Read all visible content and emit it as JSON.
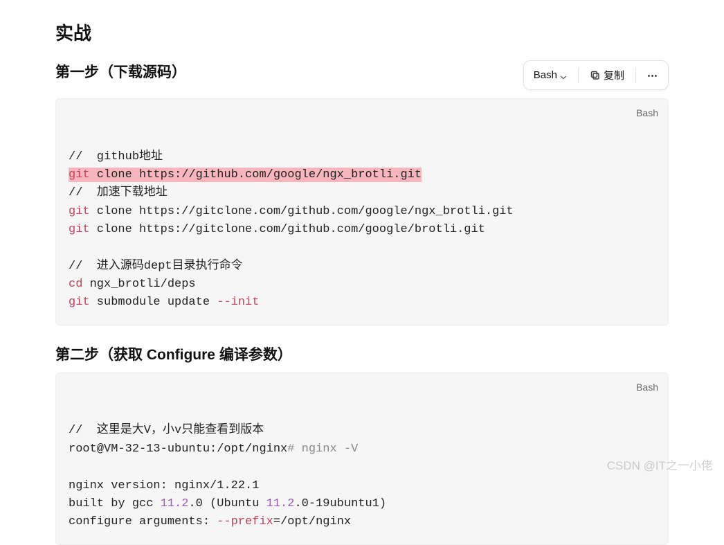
{
  "title": "实战",
  "toolbar": {
    "lang": "Bash",
    "copy": "复制",
    "more": "⋯"
  },
  "step1": {
    "heading": "第一步（下载源码）",
    "lang_label": "Bash",
    "code": {
      "c1_slashes": "//",
      "c1_text": "  github地址",
      "l2_git": "git",
      "l2_rest": " clone https://github.com/google/ngx_brotli.git",
      "c3_slashes": "//",
      "c3_text": "  加速下载地址",
      "l4_git": "git",
      "l4_rest": " clone https://gitclone.com/github.com/google/ngx_brotli.git",
      "l5_git": "git",
      "l5_rest": " clone https://gitclone.com/github.com/google/brotli.git",
      "c7_slashes": "//",
      "c7_text": "  进入源码dept目录执行命令",
      "l8_cd": "cd",
      "l8_rest": " ngx_brotli/deps",
      "l9_git": "git",
      "l9_mid": " submodule update ",
      "l9_flag": "--init"
    }
  },
  "step2": {
    "heading": "第二步（获取 Configure 编译参数）",
    "lang_label": "Bash",
    "code": {
      "c1_slashes": "//",
      "c1_text": "  这里是大V，小v只能查看到版本",
      "l2_pre": "root@VM-32-13-ubuntu:/opt/nginx",
      "l2_hash": "#",
      "l2_cmd": " nginx -V",
      "l4": "nginx version: nginx/1.22.1",
      "l5_a": "built by gcc ",
      "l5_v1": "11.2",
      "l5_b": ".0 (Ubuntu ",
      "l5_v2": "11.2",
      "l5_c": ".0-19ubuntu1)",
      "l6_a": "configure arguments: ",
      "l6_flag": "--prefix",
      "l6_b": "=/opt/nginx"
    }
  },
  "watermark": "CSDN @IT之一小佬"
}
